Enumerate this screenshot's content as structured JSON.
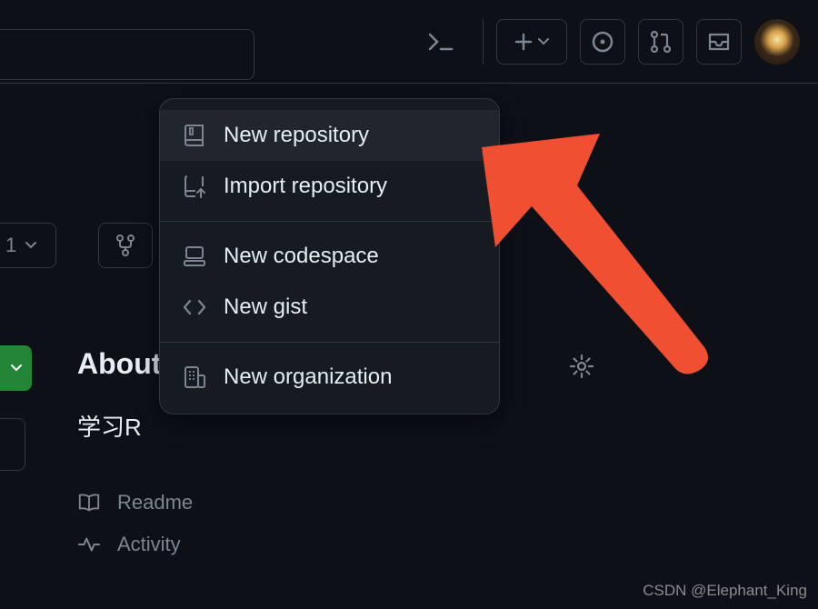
{
  "topbar": {
    "count_text": "1"
  },
  "dropdown": {
    "items": [
      {
        "label": "New repository",
        "icon": "repo-icon"
      },
      {
        "label": "Import repository",
        "icon": "repo-push-icon"
      },
      {
        "label": "New codespace",
        "icon": "codespaces-icon"
      },
      {
        "label": "New gist",
        "icon": "code-icon"
      },
      {
        "label": "New organization",
        "icon": "organization-icon"
      }
    ]
  },
  "about": {
    "heading": "About",
    "description": "学习R"
  },
  "meta": {
    "readme": "Readme",
    "activity": "Activity"
  },
  "watermark": "CSDN @Elephant_King"
}
